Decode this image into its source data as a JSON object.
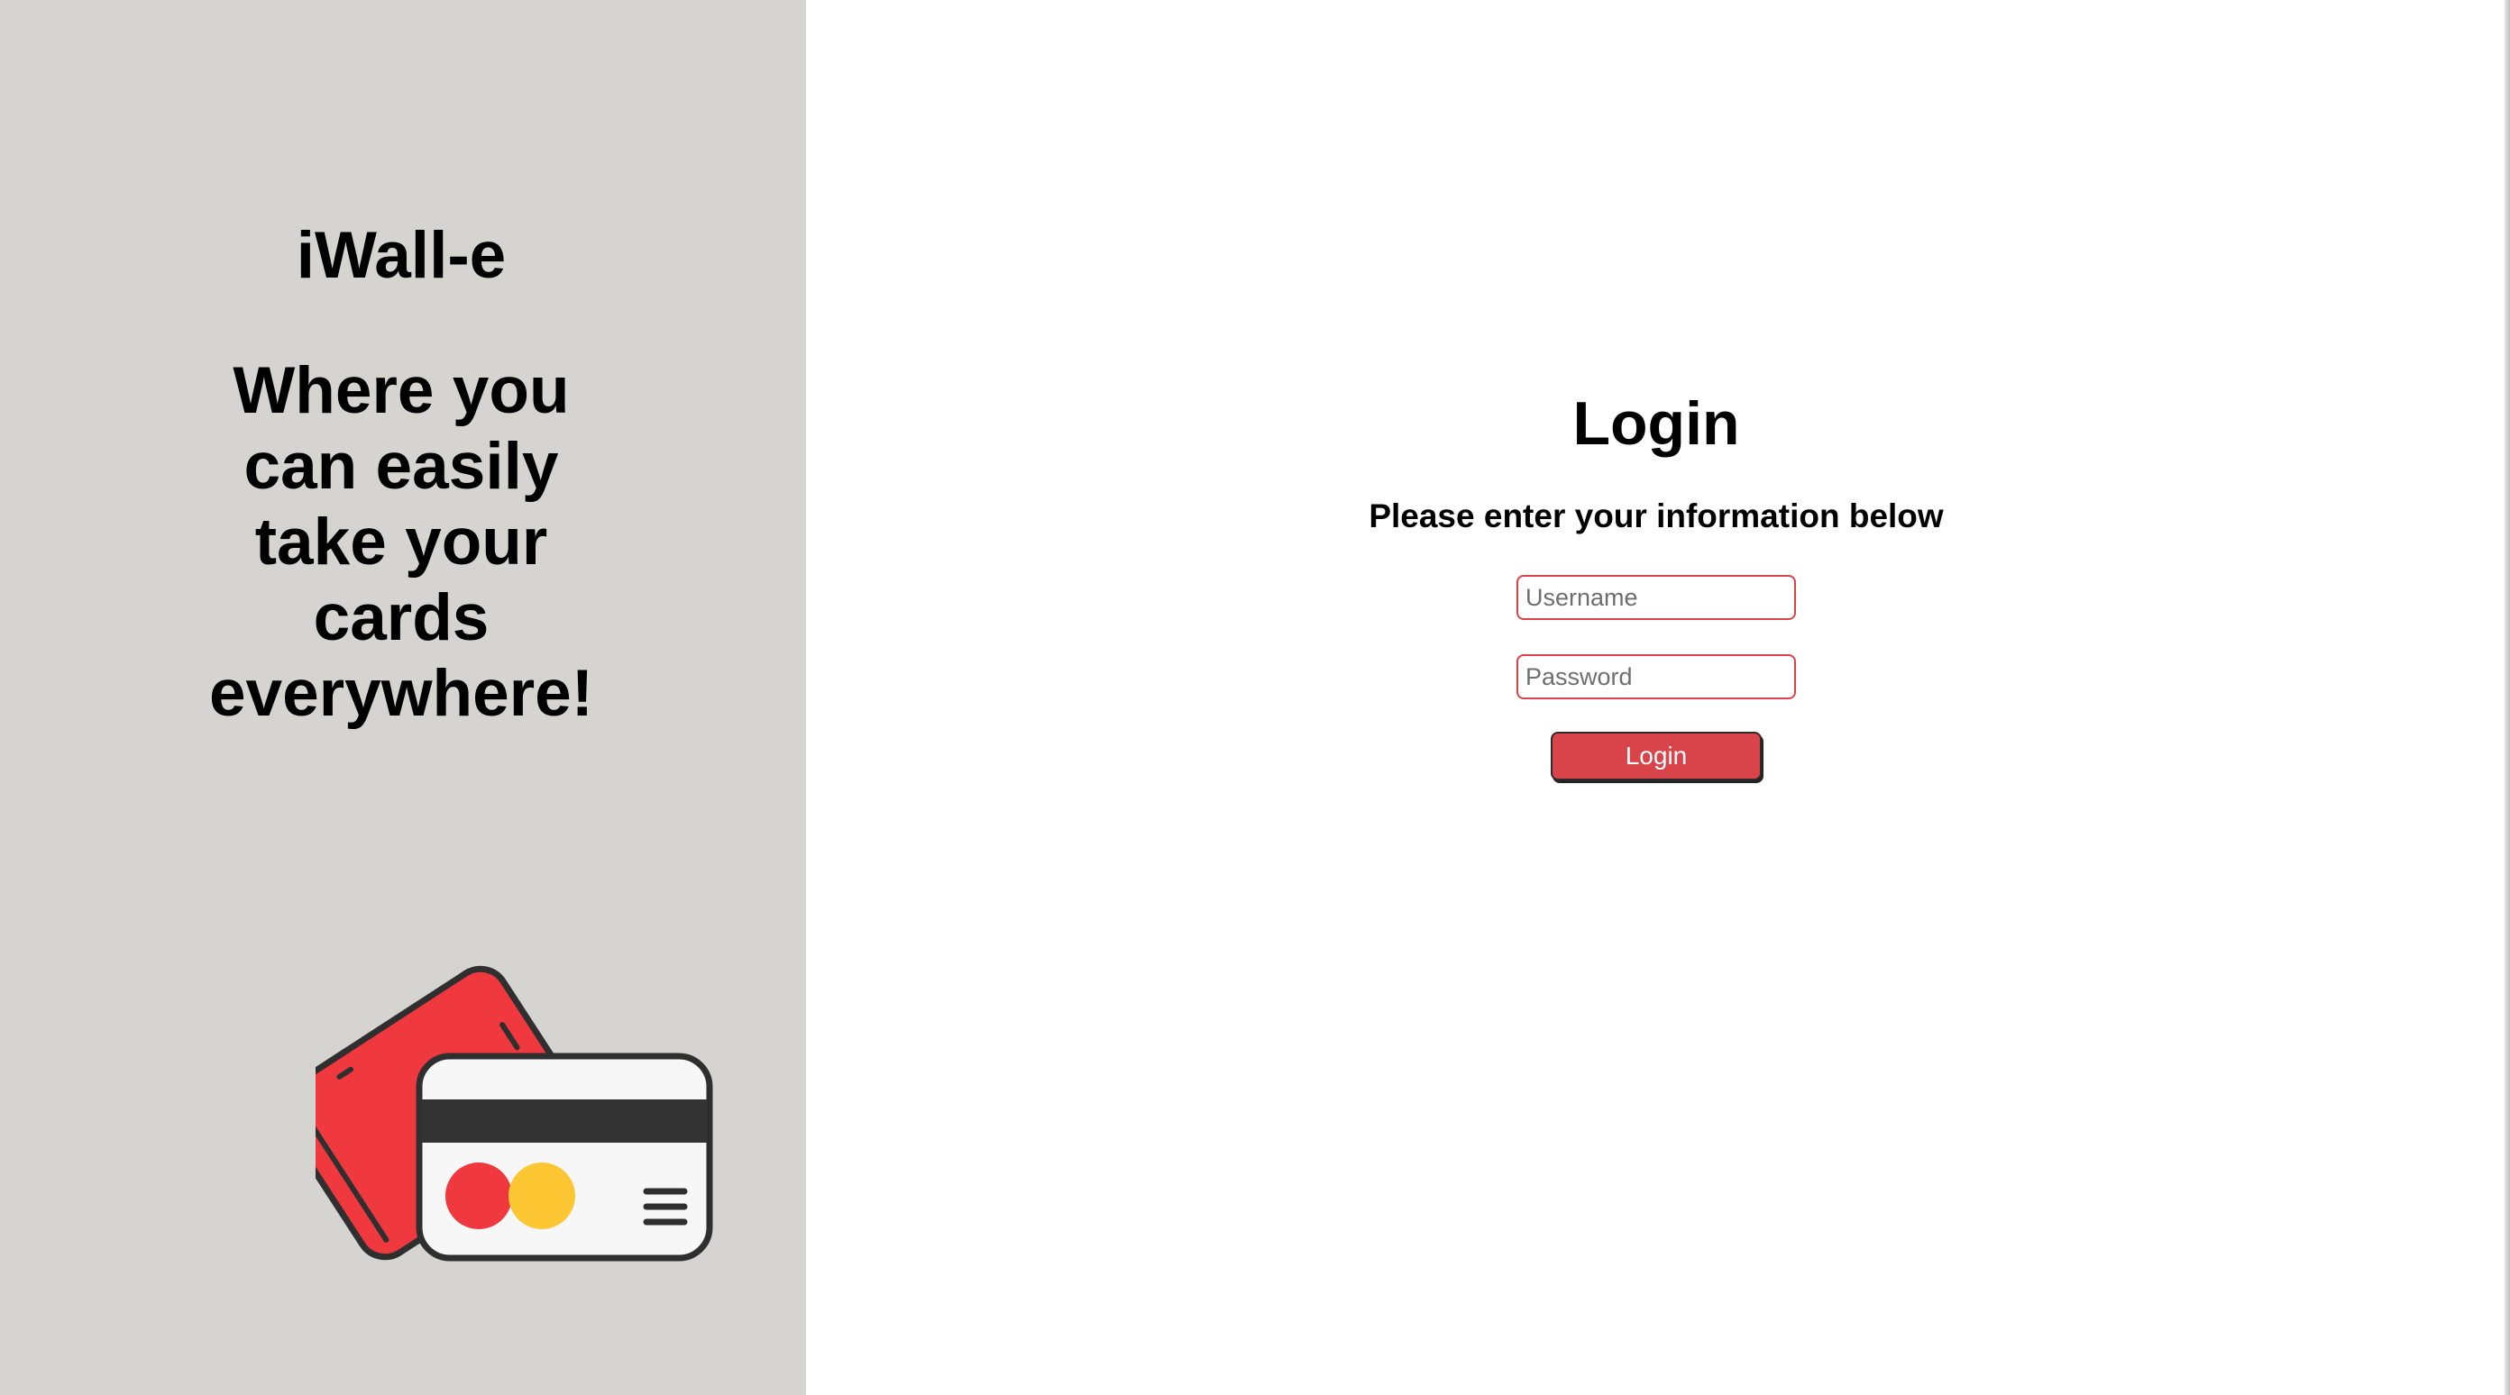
{
  "brand": {
    "name": "iWall-e",
    "tagline": "Where you can easily take your cards everywhere!"
  },
  "login": {
    "title": "Login",
    "subtitle": "Please enter your information below",
    "username_placeholder": "Username",
    "password_placeholder": "Password",
    "button_label": "Login"
  },
  "colors": {
    "left_panel_bg": "#d5d4d0",
    "accent_red": "#d9434a",
    "card_red": "#f0393f",
    "card_yellow": "#fdc633",
    "card_stripe": "#333333"
  },
  "icons": {
    "illustration": "credit-cards-icon"
  }
}
